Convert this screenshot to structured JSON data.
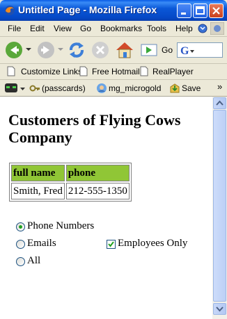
{
  "window": {
    "title": "Untitled Page - Mozilla Firefox"
  },
  "menu": {
    "items": [
      "File",
      "Edit",
      "View",
      "Go",
      "Bookmarks",
      "Tools",
      "Help"
    ]
  },
  "nav": {
    "go_label": "Go"
  },
  "bookmarks": {
    "items": [
      "Customize Links",
      "Free Hotmail",
      "RealPlayer"
    ]
  },
  "extensions": {
    "passcards": "(passcards)",
    "profile": "mg_microgold",
    "save": "Save"
  },
  "page": {
    "heading": "Customers of Flying Cows Company",
    "table": {
      "headers": [
        "full name",
        "phone"
      ],
      "rows": [
        [
          "Smith, Fred",
          "212-555-1350"
        ]
      ]
    },
    "options": {
      "phone_numbers": "Phone Numbers",
      "emails": "Emails",
      "all": "All",
      "employees_only": "Employees Only"
    },
    "state": {
      "selected_radio": "Phone Numbers",
      "employees_only_checked": true
    }
  },
  "colors": {
    "table_header_bg": "#90c636",
    "titlebar_blue": "#0548c6",
    "radio_dot": "#21a121"
  }
}
